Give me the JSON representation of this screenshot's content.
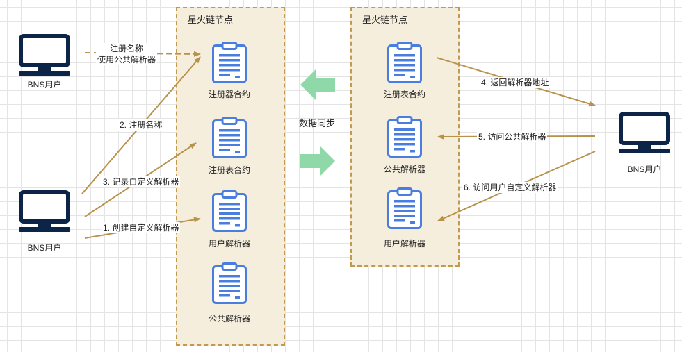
{
  "nodes": {
    "left_title": "星火链节点",
    "right_title": "星火链节点"
  },
  "users": {
    "top_left": "BNS用户",
    "bottom_left": "BNS用户",
    "right": "BNS用户"
  },
  "left_node_contracts": {
    "registrar": "注册器合约",
    "registry": "注册表合约",
    "user_resolver": "用户解析器",
    "public_resolver": "公共解析器"
  },
  "right_node_contracts": {
    "registry": "注册表合约",
    "public_resolver": "公共解析器",
    "user_resolver": "用户解析器"
  },
  "flows": {
    "register_line1": "注册名称",
    "register_line2": "使用公共解析器",
    "step2": "2. 注册名称",
    "step3": "3. 记录自定义解析器",
    "step1": "1. 创建自定义解析器",
    "step4": "4. 返回解析器地址",
    "step5": "5. 访问公共解析器",
    "step6": "6. 访问用户自定义解析器"
  },
  "sync": {
    "label": "数据同步"
  },
  "colors": {
    "arrow": "#b8924a",
    "sync_arrow": "#8fd9a8",
    "clipboard": "#4a7de0",
    "monitor": "#0b2447",
    "node_fill": "#f5eedc",
    "node_border": "#c19a4f"
  },
  "icons": {
    "user": "computer-monitor-icon",
    "contract": "clipboard-document-icon",
    "sync": "arrow-icon"
  }
}
